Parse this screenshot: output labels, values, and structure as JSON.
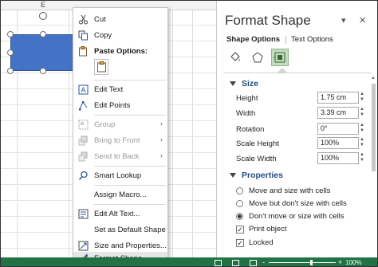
{
  "sheet": {
    "column_label": "E",
    "shape_color": "#4472c4"
  },
  "context_menu": {
    "items": [
      {
        "label": "Cut",
        "icon": "scissors-icon",
        "enabled": true
      },
      {
        "label": "Copy",
        "icon": "copy-icon",
        "enabled": true
      },
      {
        "label": "Paste Options:",
        "icon": "paste-icon",
        "enabled": true
      },
      {
        "label": "Edit Text",
        "icon": "edit-text-icon",
        "enabled": true
      },
      {
        "label": "Edit Points",
        "icon": "edit-points-icon",
        "enabled": true
      },
      {
        "label": "Group",
        "icon": "group-icon",
        "enabled": false,
        "submenu": true
      },
      {
        "label": "Bring to Front",
        "icon": "bring-to-front-icon",
        "enabled": false,
        "submenu": true
      },
      {
        "label": "Send to Back",
        "icon": "send-to-back-icon",
        "enabled": false,
        "submenu": true
      },
      {
        "label": "Smart Lookup",
        "icon": "search-icon",
        "enabled": true
      },
      {
        "label": "Assign Macro...",
        "enabled": true
      },
      {
        "label": "Edit Alt Text...",
        "icon": "alt-text-icon",
        "enabled": true
      },
      {
        "label": "Set as Default Shape",
        "enabled": true
      },
      {
        "label": "Size and Properties...",
        "icon": "size-properties-icon",
        "enabled": true
      },
      {
        "label": "Format Shape...",
        "icon": "format-shape-icon",
        "enabled": true,
        "highlighted": true
      }
    ]
  },
  "pane": {
    "title": "Format Shape",
    "tabs": [
      {
        "label": "Shape Options",
        "active": true
      },
      {
        "label": "Text Options",
        "active": false
      }
    ],
    "icons": [
      "fill-line-icon",
      "effects-icon",
      "size-properties-icon"
    ],
    "accent": "#c5dbc2",
    "size_section": {
      "heading": "Size",
      "fields": [
        {
          "label": "Height",
          "value": "1.75 cm"
        },
        {
          "label": "Width",
          "value": "3.39 cm"
        },
        {
          "label": "Rotation",
          "value": "0°"
        },
        {
          "label": "Scale Height",
          "value": "100%"
        },
        {
          "label": "Scale Width",
          "value": "100%"
        }
      ]
    },
    "properties_section": {
      "heading": "Properties",
      "radios": [
        {
          "label": "Move and size with cells",
          "selected": false
        },
        {
          "label": "Move but don't size with cells",
          "selected": false
        },
        {
          "label": "Don't move or size with cells",
          "selected": true
        }
      ],
      "checkboxes": [
        {
          "label": "Print object",
          "checked": true
        },
        {
          "label": "Locked",
          "checked": true
        }
      ]
    }
  },
  "status_bar": {
    "zoom": "100%",
    "minus": "-",
    "plus": "+",
    "color": "#217346"
  }
}
